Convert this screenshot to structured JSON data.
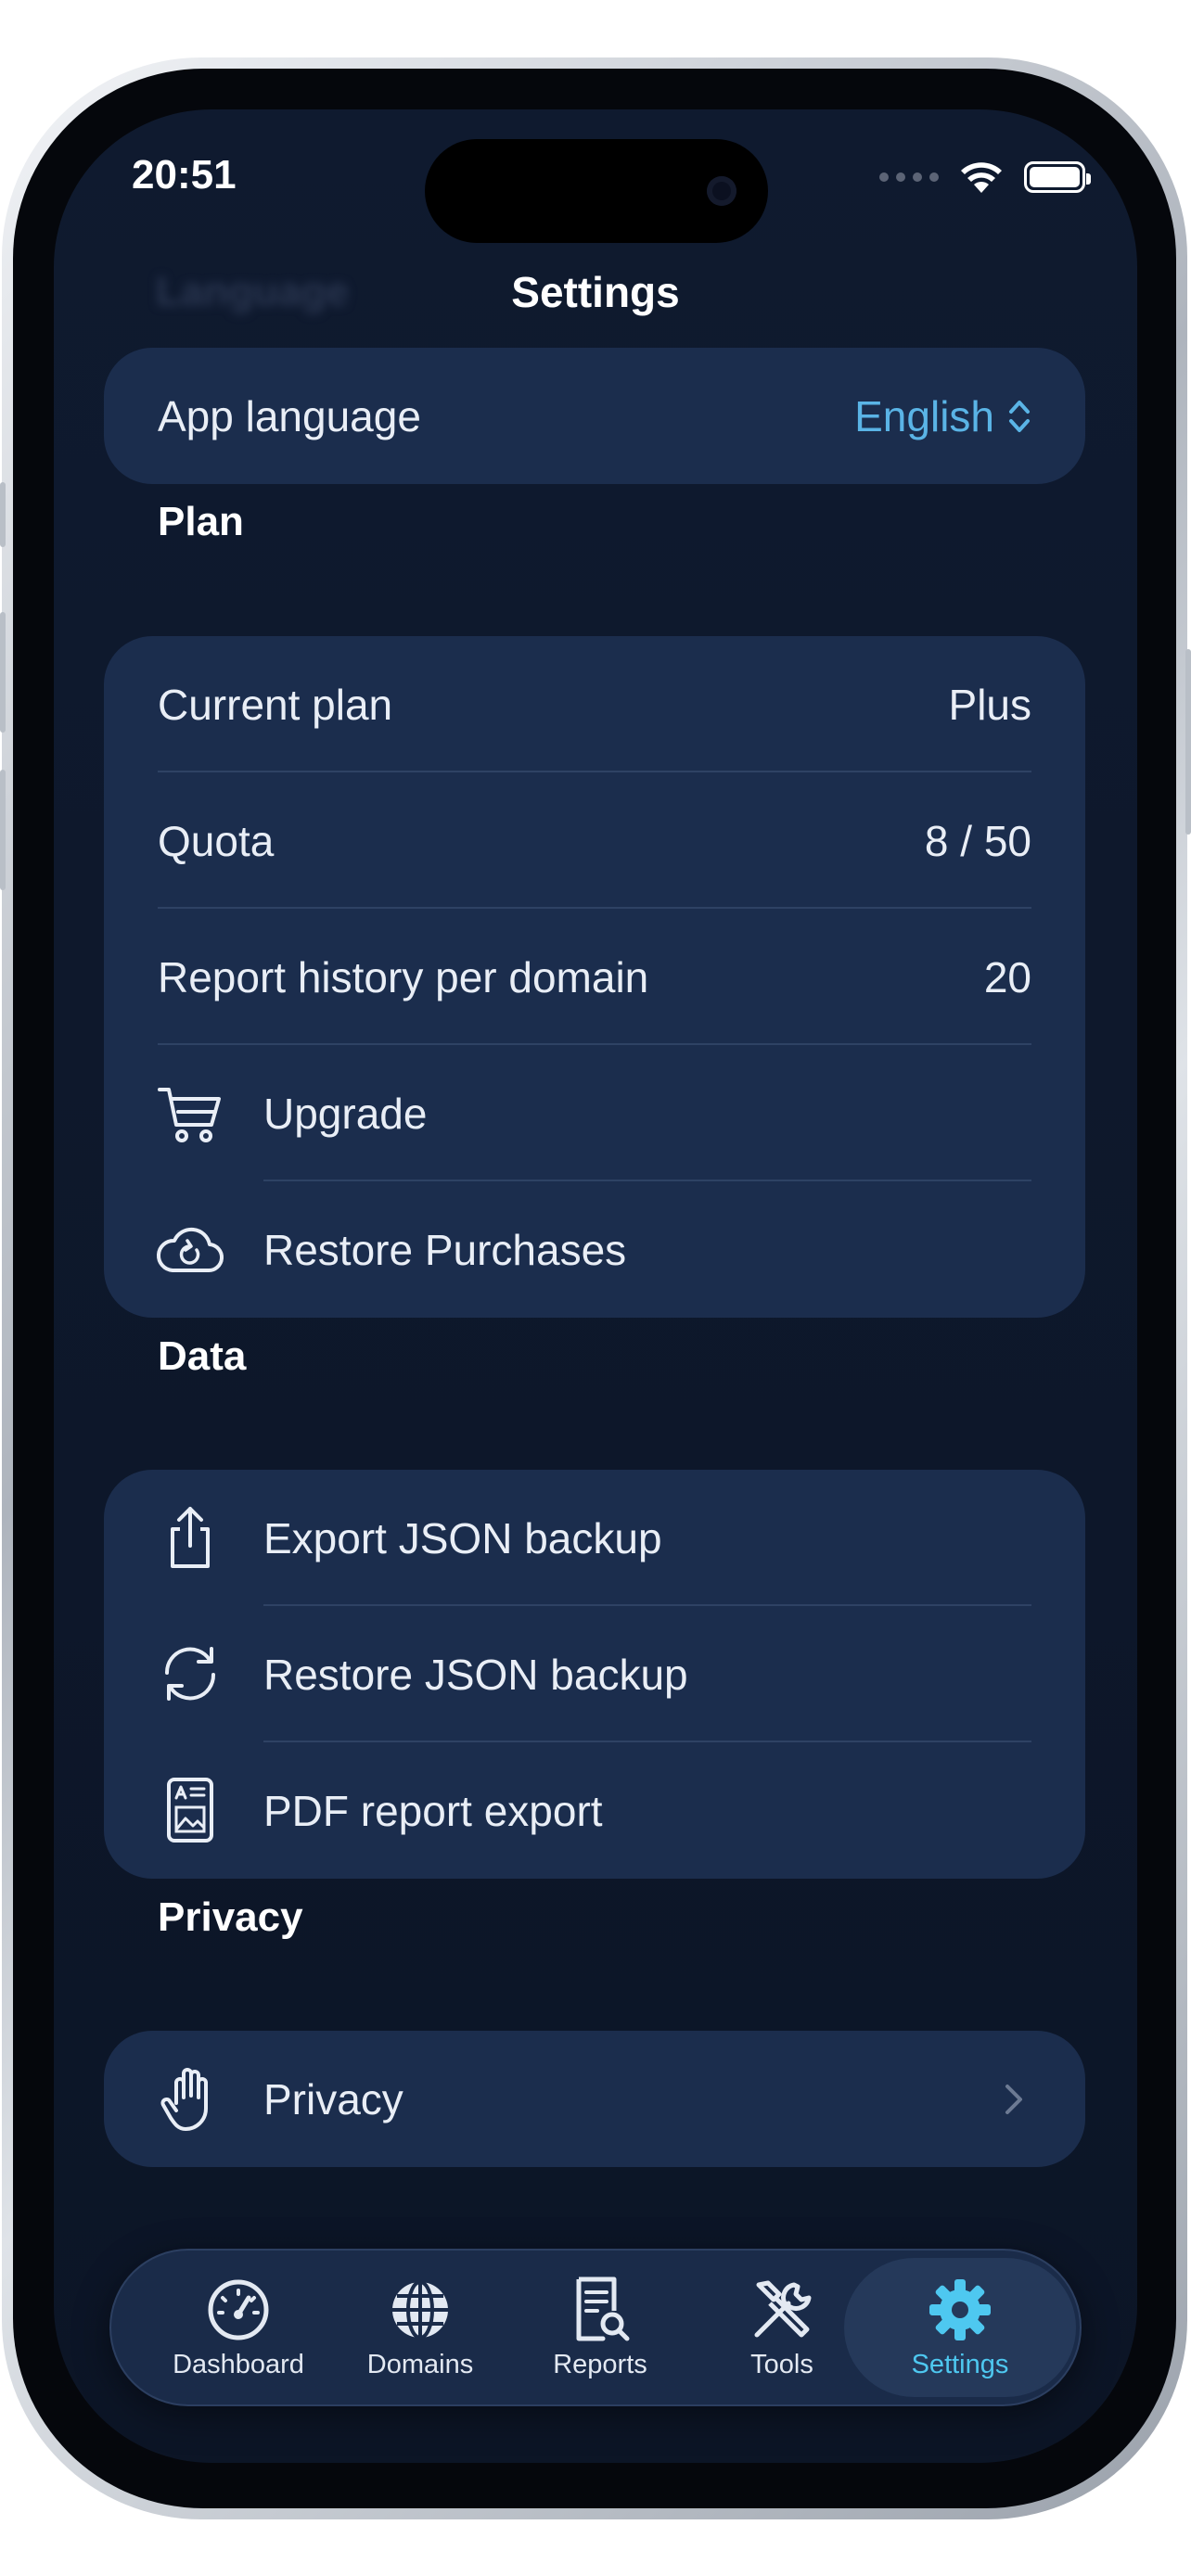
{
  "status_bar": {
    "time": "20:51"
  },
  "blurred_heading": "Language",
  "nav": {
    "title": "Settings"
  },
  "language": {
    "label": "App language",
    "value": "English"
  },
  "plan": {
    "heading": "Plan",
    "rows": [
      {
        "label": "Current plan",
        "value": "Plus"
      },
      {
        "label": "Quota",
        "value": "8 / 50"
      },
      {
        "label": "Report history per domain",
        "value": "20"
      }
    ],
    "upgrade_label": "Upgrade",
    "restore_label": "Restore Purchases"
  },
  "data": {
    "heading": "Data",
    "export_label": "Export JSON backup",
    "restore_label": "Restore JSON backup",
    "pdf_label": "PDF report export"
  },
  "privacy": {
    "heading": "Privacy",
    "label": "Privacy"
  },
  "tabs": [
    {
      "label": "Dashboard"
    },
    {
      "label": "Domains"
    },
    {
      "label": "Reports"
    },
    {
      "label": "Tools"
    },
    {
      "label": "Settings"
    }
  ],
  "colors": {
    "accent": "#4ec8f0",
    "card": "#1b2d4d",
    "background": "#0f1a2f"
  }
}
